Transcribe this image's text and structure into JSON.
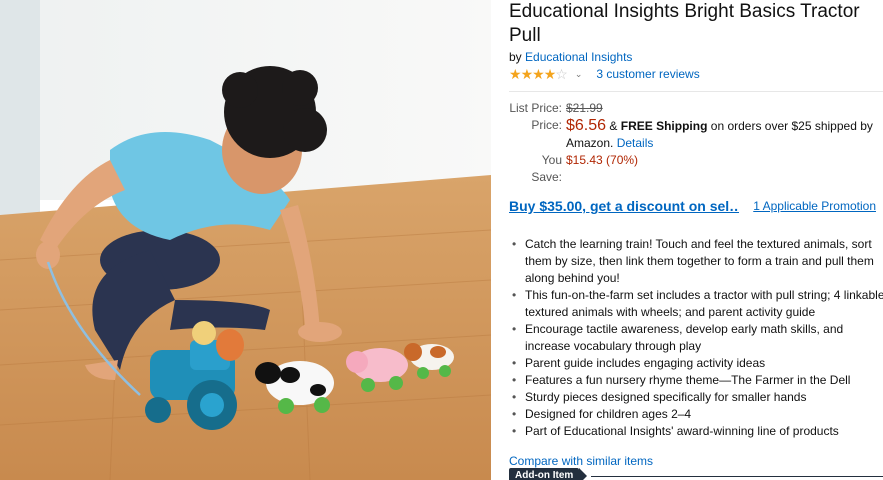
{
  "product": {
    "title": "Educational Insights Bright Basics Tractor Pull",
    "by_prefix": "by",
    "brand": "Educational Insights",
    "rating_stars": 4,
    "rating_max": 5,
    "reviews_link": "3 customer reviews"
  },
  "pricing": {
    "list_label": "List Price:",
    "list_value": "$21.99",
    "price_label": "Price:",
    "price_value": "$6.56",
    "shipping_amp": "&",
    "shipping_bold": "FREE Shipping",
    "shipping_rest": "on orders over $25 shipped by Amazon.",
    "details_link": "Details",
    "save_label": "You Save:",
    "save_value": "$15.43 (70%)"
  },
  "promo": {
    "main": "Buy $35.00, get a discount on sel…",
    "side": "1 Applicable Promotion"
  },
  "bullets": [
    "Catch the learning train! Touch and feel the textured animals, sort them by size, then link them together to form a train and pull them along behind you!",
    "This fun-on-the-farm set includes a tractor with pull string; 4 linkable textured animals with wheels; and parent activity guide",
    "Encourage tactile awareness, develop early math skills, and increase vocabulary through play",
    "Parent guide includes engaging activity ideas",
    "Features a fun nursery rhyme theme—The Farmer in the Dell",
    "Sturdy pieces designed specifically for smaller hands",
    "Designed for children ages 2–4",
    "Part of Educational Insights' award-winning line of products"
  ],
  "compare_link": "Compare with similar items",
  "addon_badge": "Add-on Item",
  "colors": {
    "link": "#0066c0",
    "price": "#b12704",
    "star": "#f4a41d",
    "badge": "#232f3e"
  },
  "icons": {
    "rating": "star-icon",
    "rating_menu": "chevron-down-icon"
  }
}
